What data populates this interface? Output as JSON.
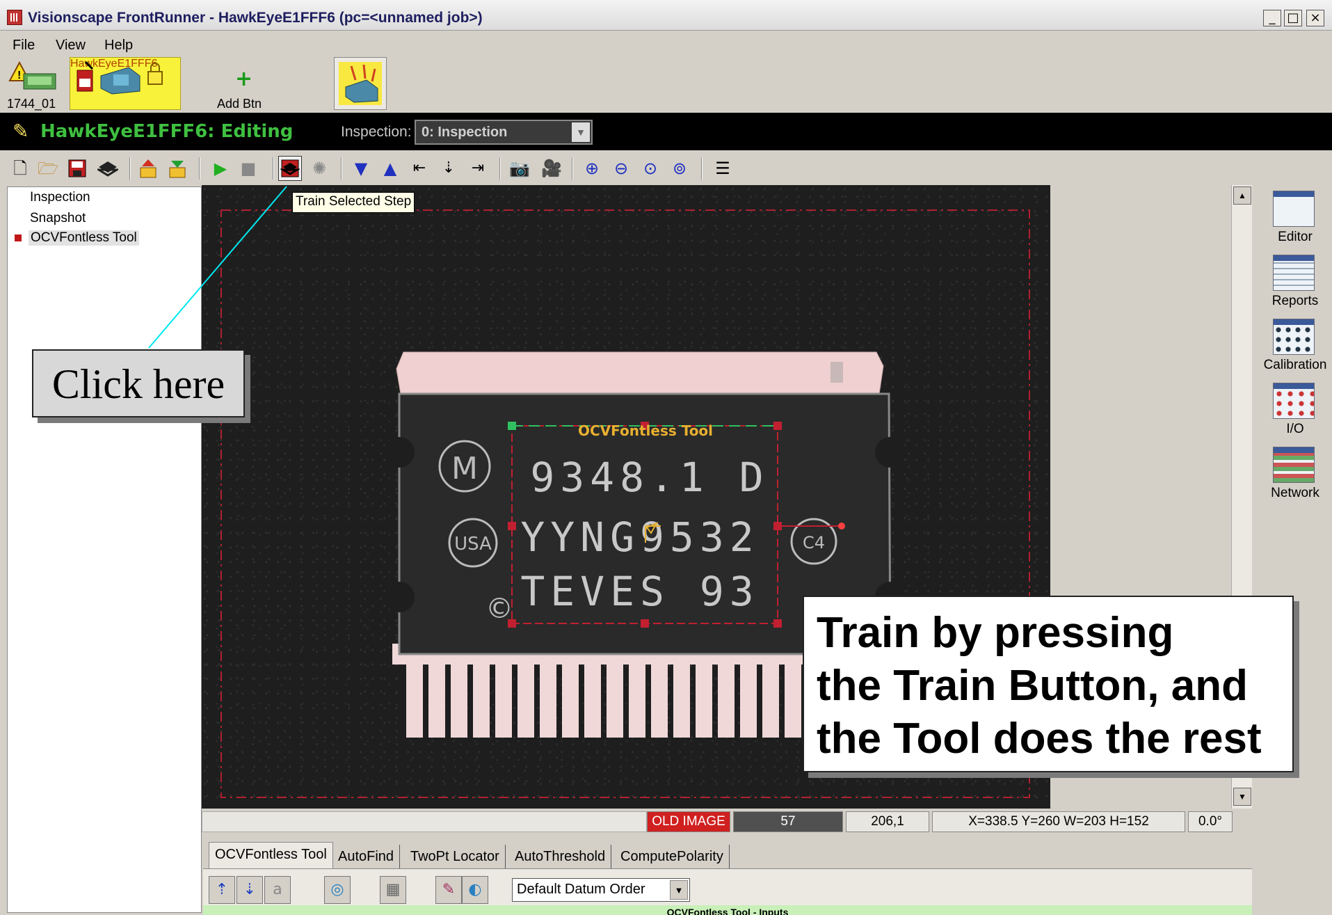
{
  "window": {
    "title": "Visionscape FrontRunner - HawkEyeE1FFF6 (pc=<unnamed job>)",
    "min_label": "_",
    "max_label": "□",
    "close_label": "×"
  },
  "menu": [
    "File",
    "View",
    "Help"
  ],
  "devices": {
    "pc_label": "1744_01",
    "camera_label": "HawkEyeE1FFF6",
    "add_label": "Add Btn"
  },
  "status": {
    "mode": "HawkEyeE1FFF6: Editing",
    "inspection_label": "Inspection:",
    "inspection_value": "0: Inspection"
  },
  "tooltip": "Train Selected Step",
  "tree": [
    "Inspection",
    "Snapshot",
    "OCVFontless Tool"
  ],
  "tool_overlay": {
    "name": "OCVFontless Tool",
    "line1": "9348.1 D",
    "line2": "YYNG9532",
    "line3": "TEVES 93",
    "logo": "M",
    "usa": "USA",
    "c4": "C4",
    "copyright": "©"
  },
  "side_tools": [
    "Editor",
    "Reports",
    "Calibration",
    "I/O",
    "Network"
  ],
  "status_row": {
    "old_image": "OLD IMAGE",
    "count": "57",
    "pos": "206,1",
    "roi": "X=338.5 Y=260 W=203 H=152",
    "angle": "0.0°"
  },
  "tabs": [
    "OCVFontless Tool",
    "AutoFind",
    "TwoPt Locator",
    "AutoThreshold",
    "ComputePolarity"
  ],
  "datum_order": "Default Datum Order",
  "props_header": "OCVFontless Tool - Inputs",
  "callouts": {
    "click_here": "Click here",
    "train_line1": "Train by pressing",
    "train_line2": "the Train Button, and",
    "train_line3": "the Tool does the rest"
  },
  "colors": {
    "editing_green": "#3fc040",
    "old_image_red": "#d02020",
    "roi_green": "#30c060",
    "roi_red": "#c02030",
    "pointer_cyan": "#00e8f0"
  }
}
